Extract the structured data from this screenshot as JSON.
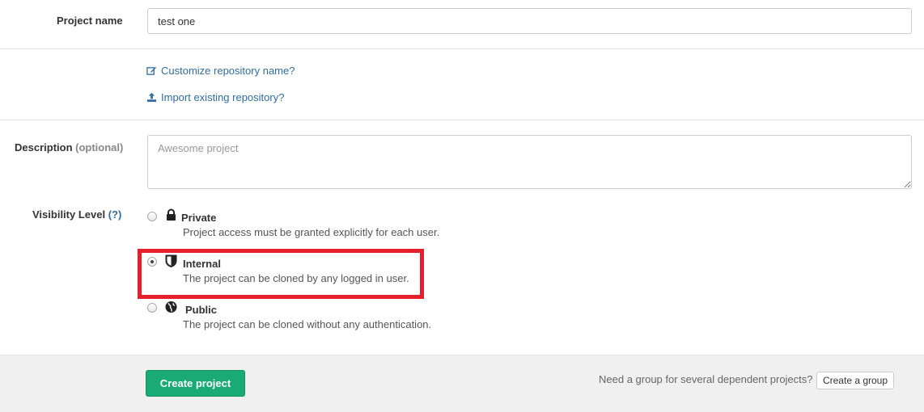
{
  "project_name": {
    "label": "Project name",
    "value": "test one"
  },
  "links": {
    "customize": "Customize repository name?",
    "import": "Import existing repository?"
  },
  "description": {
    "label": "Description",
    "optional": "(optional)",
    "placeholder": "Awesome project"
  },
  "visibility": {
    "label": "Visibility Level",
    "help": "(?)",
    "options": [
      {
        "title": "Private",
        "description": "Project access must be granted explicitly for each user.",
        "icon": "lock-icon",
        "selected": false
      },
      {
        "title": "Internal",
        "description": "The project can be cloned by any logged in user.",
        "icon": "shield-icon",
        "selected": true
      },
      {
        "title": "Public",
        "description": "The project can be cloned without any authentication.",
        "icon": "globe-icon",
        "selected": false
      }
    ]
  },
  "footer": {
    "create_label": "Create project",
    "group_prompt": "Need a group for several dependent projects?",
    "group_button": "Create a group"
  },
  "colors": {
    "primary": "#1aaa75",
    "link": "#2e6da4",
    "highlight": "#e3202b"
  }
}
